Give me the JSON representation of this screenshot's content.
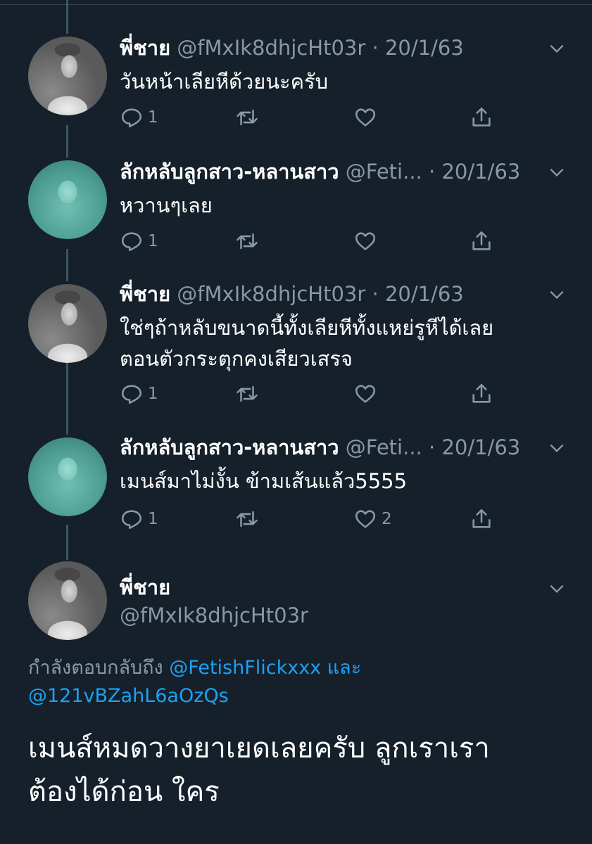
{
  "thread": [
    {
      "name": "พี่ชาย",
      "handle": "@fMxIk8dhjcHt03r",
      "dot": "·",
      "date": "20/1/63",
      "avatar": "man-photo",
      "lines": [
        "วันหน้าเลียหีด้วยนะครับ"
      ],
      "reply_count": "1",
      "like_count": ""
    },
    {
      "name": "ลักหลับลูกสาว-หลานสาว",
      "handle": "@Feti...",
      "dot": "·",
      "date": "20/1/63",
      "avatar": "teal-photo",
      "lines": [
        "หวานๆเลย"
      ],
      "reply_count": "1",
      "like_count": ""
    },
    {
      "name": "พี่ชาย",
      "handle": "@fMxIk8dhjcHt03r",
      "dot": "·",
      "date": "20/1/63",
      "avatar": "man-photo",
      "lines": [
        "ใช่ๆถ้าหลับขนาดนี้ทั้งเลียหีทั้งแหย่รูหีได้เลย",
        "ตอนตัวกระตุกคงเสียวเสรจ"
      ],
      "reply_count": "1",
      "like_count": ""
    },
    {
      "name": "ลักหลับลูกสาว-หลานสาว",
      "handle": "@Feti...",
      "dot": "·",
      "date": "20/1/63",
      "avatar": "teal-photo",
      "lines": [
        "เมนส์มาไม่งั้น ข้ามเส้นแล้ว5555"
      ],
      "reply_count": "1",
      "like_count": "2"
    }
  ],
  "main_tweet": {
    "name": "พี่ชาย",
    "handle": "@fMxIk8dhjcHt03r",
    "replying_prefix": "กำลังตอบกลับถึง",
    "mention_1": "@FetishFlickxxx",
    "conjunction": "และ",
    "mention_2": "@121vBZahL6aOzQs",
    "text_line_1": "เมนส์หมดวางยาเยดเลยครับ ลูกเราเรา",
    "text_line_2": "ต้องได้ก่อน ใคร"
  },
  "colors": {
    "background": "#15202b",
    "secondary_text": "#8899a6",
    "link": "#1da1f2"
  },
  "icons": [
    "reply-icon",
    "retweet-icon",
    "like-icon",
    "share-icon",
    "chevron-down-icon"
  ]
}
